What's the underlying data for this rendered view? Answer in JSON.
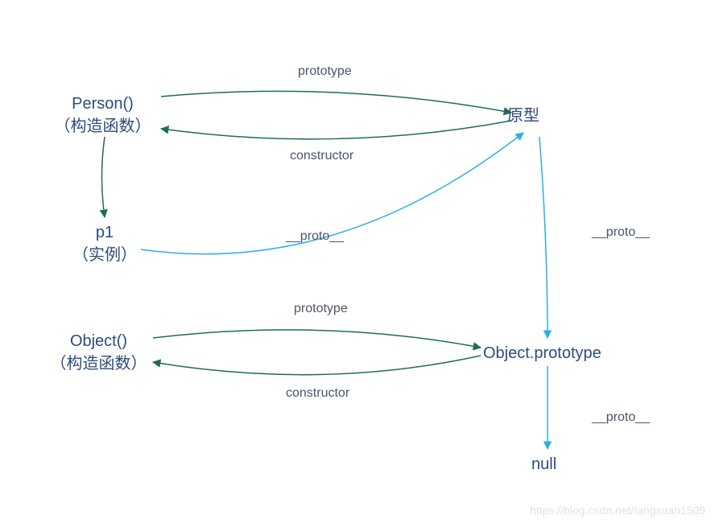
{
  "nodes": {
    "person": {
      "line1": "Person()",
      "line2": "（构造函数）"
    },
    "proto": {
      "label": "原型"
    },
    "p1": {
      "line1": "p1",
      "line2": "（实例）"
    },
    "object": {
      "line1": "Object()",
      "line2": "（构造函数）"
    },
    "objproto": {
      "label": "Object.prototype"
    },
    "null": {
      "label": "null"
    }
  },
  "edges": {
    "person_to_proto": "prototype",
    "proto_to_person": "constructor",
    "p1_to_proto": "__proto__",
    "proto_to_objproto": "__proto__",
    "object_to_objproto": "prototype",
    "objproto_to_object": "constructor",
    "objproto_to_null": "__proto__"
  },
  "watermark": "https://blog.csdn.net/fangxuan1509",
  "colors": {
    "node_text": "#2e4a7d",
    "green": "#1f6d57",
    "blue": "#2bb0e6"
  }
}
